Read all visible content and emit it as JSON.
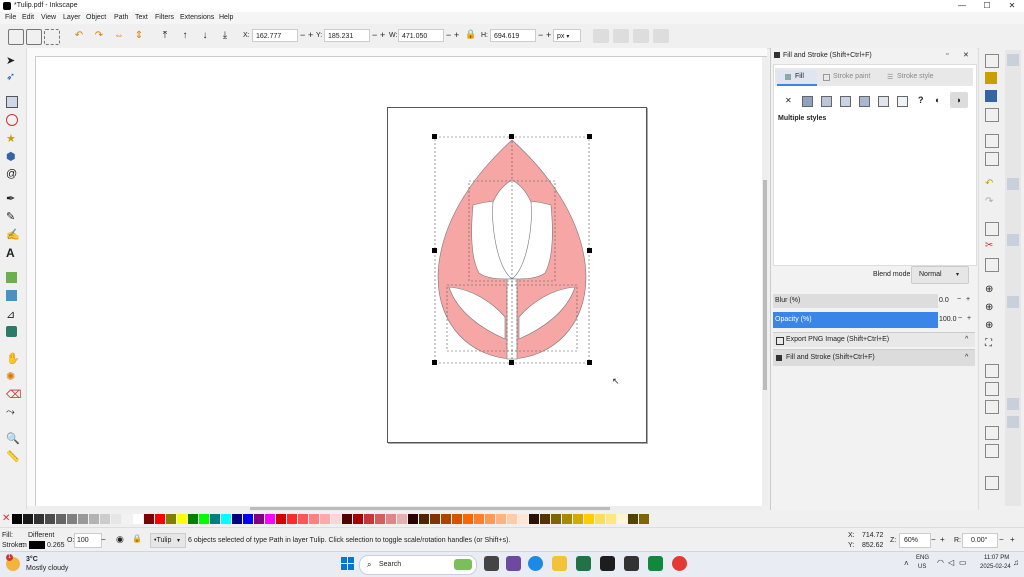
{
  "window": {
    "title": "*Tulip.pdf - Inkscape",
    "minimize": "—",
    "maximize": "☐",
    "close": "✕"
  },
  "menubar": {
    "items": [
      "File",
      "Edit",
      "View",
      "Layer",
      "Object",
      "Path",
      "Text",
      "Filters",
      "Extensions",
      "Help"
    ]
  },
  "toolbar": {
    "x_label": "X:",
    "x_value": "162.777",
    "y_label": "Y:",
    "y_value": "185.231",
    "w_label": "W:",
    "w_value": "471.050",
    "h_label": "H:",
    "h_value": "694.619",
    "unit": "px",
    "minus": "−",
    "plus": "+"
  },
  "panel": {
    "dialog_title": "Fill and Stroke (Shift+Ctrl+F)",
    "tabs": [
      {
        "label": "Fill"
      },
      {
        "label": "Stroke paint"
      },
      {
        "label": "Stroke style"
      }
    ],
    "paint_none": "✕",
    "paint_unknown": "?",
    "status_text": "Multiple styles",
    "blend_label": "Blend mode:",
    "blend_value": "Normal",
    "blur_label": "Blur (%)",
    "blur_value": "0.0",
    "opacity_label": "Opacity (%)",
    "opacity_value": "100.0",
    "export_dock": "Export PNG Image (Shift+Ctrl+E)",
    "fill_dock": "Fill and Stroke (Shift+Ctrl+F)",
    "collapse": "^",
    "close": "✕",
    "menu": "▫"
  },
  "statusbar": {
    "fill_label": "Fill:",
    "fill_value": "Different",
    "stroke_label": "Stroke:",
    "stroke_short": "m",
    "stroke_width": "0.265",
    "opacity_label": "O:",
    "opacity_value": "100",
    "layer": "•Tulip",
    "message": "6 objects selected of type Path in layer Tulip. Click selection to toggle scale/rotation handles (or Shift+s).",
    "x_label": "X:",
    "x_value": "714.72",
    "y_label": "Y:",
    "y_value": "852.62",
    "zoom_label": "Z:",
    "zoom_value": "60%",
    "rot_label": "R:",
    "rot_value": "0.00°"
  },
  "taskbar": {
    "temp": "3°C",
    "weather": "Mostly cloudy",
    "search": "Search",
    "lang_top": "ENG",
    "lang_bottom": "US",
    "time": "11:07 PM",
    "date": "2025-02-24",
    "weather_badge": "1"
  },
  "colors": {
    "accent": "#3a86e8",
    "tulip_fill": "#f7a6a6",
    "petal_fill": "#ffffff",
    "panel_bg": "#f2f2f2"
  },
  "palette": [
    "#000000",
    "#1a1a1a",
    "#333333",
    "#4d4d4d",
    "#666666",
    "#808080",
    "#999999",
    "#b3b3b3",
    "#cccccc",
    "#e6e6e6",
    "#f2f2f2",
    "#ffffff",
    "#800000",
    "#ff0000",
    "#808000",
    "#ffff00",
    "#008000",
    "#00ff00",
    "#008080",
    "#00ffff",
    "#000080",
    "#0000ff",
    "#800080",
    "#ff00ff",
    "#d40000",
    "#ff2a2a",
    "#ff5555",
    "#ff8080",
    "#ffaaaa",
    "#ffd5d5",
    "#550000",
    "#aa0000",
    "#c83737",
    "#d35f5f",
    "#de8787",
    "#e9afaf",
    "#2b0000",
    "#552200",
    "#803300",
    "#aa4400",
    "#d45500",
    "#ff6600",
    "#ff7f2a",
    "#ff9955",
    "#ffb380",
    "#ffccaa",
    "#ffe6d5",
    "#2b1100",
    "#553300",
    "#806600",
    "#aa8800",
    "#d4aa00",
    "#ffcc00",
    "#ffdd55",
    "#ffe680",
    "#fff6d5",
    "#554400",
    "#806600"
  ]
}
